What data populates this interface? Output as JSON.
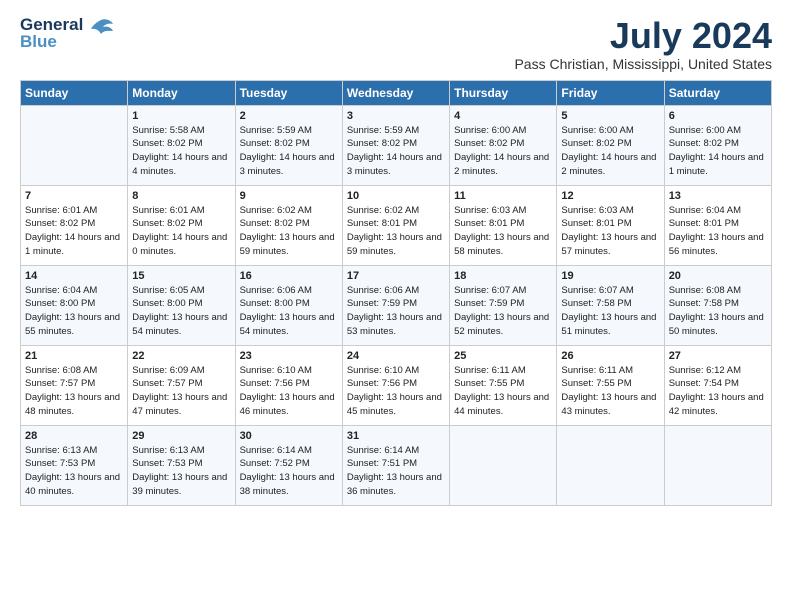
{
  "logo": {
    "line1": "General",
    "line2": "Blue"
  },
  "title": "July 2024",
  "subtitle": "Pass Christian, Mississippi, United States",
  "headers": [
    "Sunday",
    "Monday",
    "Tuesday",
    "Wednesday",
    "Thursday",
    "Friday",
    "Saturday"
  ],
  "weeks": [
    [
      {
        "day": "",
        "sunrise": "",
        "sunset": "",
        "daylight": ""
      },
      {
        "day": "1",
        "sunrise": "Sunrise: 5:58 AM",
        "sunset": "Sunset: 8:02 PM",
        "daylight": "Daylight: 14 hours and 4 minutes."
      },
      {
        "day": "2",
        "sunrise": "Sunrise: 5:59 AM",
        "sunset": "Sunset: 8:02 PM",
        "daylight": "Daylight: 14 hours and 3 minutes."
      },
      {
        "day": "3",
        "sunrise": "Sunrise: 5:59 AM",
        "sunset": "Sunset: 8:02 PM",
        "daylight": "Daylight: 14 hours and 3 minutes."
      },
      {
        "day": "4",
        "sunrise": "Sunrise: 6:00 AM",
        "sunset": "Sunset: 8:02 PM",
        "daylight": "Daylight: 14 hours and 2 minutes."
      },
      {
        "day": "5",
        "sunrise": "Sunrise: 6:00 AM",
        "sunset": "Sunset: 8:02 PM",
        "daylight": "Daylight: 14 hours and 2 minutes."
      },
      {
        "day": "6",
        "sunrise": "Sunrise: 6:00 AM",
        "sunset": "Sunset: 8:02 PM",
        "daylight": "Daylight: 14 hours and 1 minute."
      }
    ],
    [
      {
        "day": "7",
        "sunrise": "Sunrise: 6:01 AM",
        "sunset": "Sunset: 8:02 PM",
        "daylight": "Daylight: 14 hours and 1 minute."
      },
      {
        "day": "8",
        "sunrise": "Sunrise: 6:01 AM",
        "sunset": "Sunset: 8:02 PM",
        "daylight": "Daylight: 14 hours and 0 minutes."
      },
      {
        "day": "9",
        "sunrise": "Sunrise: 6:02 AM",
        "sunset": "Sunset: 8:02 PM",
        "daylight": "Daylight: 13 hours and 59 minutes."
      },
      {
        "day": "10",
        "sunrise": "Sunrise: 6:02 AM",
        "sunset": "Sunset: 8:01 PM",
        "daylight": "Daylight: 13 hours and 59 minutes."
      },
      {
        "day": "11",
        "sunrise": "Sunrise: 6:03 AM",
        "sunset": "Sunset: 8:01 PM",
        "daylight": "Daylight: 13 hours and 58 minutes."
      },
      {
        "day": "12",
        "sunrise": "Sunrise: 6:03 AM",
        "sunset": "Sunset: 8:01 PM",
        "daylight": "Daylight: 13 hours and 57 minutes."
      },
      {
        "day": "13",
        "sunrise": "Sunrise: 6:04 AM",
        "sunset": "Sunset: 8:01 PM",
        "daylight": "Daylight: 13 hours and 56 minutes."
      }
    ],
    [
      {
        "day": "14",
        "sunrise": "Sunrise: 6:04 AM",
        "sunset": "Sunset: 8:00 PM",
        "daylight": "Daylight: 13 hours and 55 minutes."
      },
      {
        "day": "15",
        "sunrise": "Sunrise: 6:05 AM",
        "sunset": "Sunset: 8:00 PM",
        "daylight": "Daylight: 13 hours and 54 minutes."
      },
      {
        "day": "16",
        "sunrise": "Sunrise: 6:06 AM",
        "sunset": "Sunset: 8:00 PM",
        "daylight": "Daylight: 13 hours and 54 minutes."
      },
      {
        "day": "17",
        "sunrise": "Sunrise: 6:06 AM",
        "sunset": "Sunset: 7:59 PM",
        "daylight": "Daylight: 13 hours and 53 minutes."
      },
      {
        "day": "18",
        "sunrise": "Sunrise: 6:07 AM",
        "sunset": "Sunset: 7:59 PM",
        "daylight": "Daylight: 13 hours and 52 minutes."
      },
      {
        "day": "19",
        "sunrise": "Sunrise: 6:07 AM",
        "sunset": "Sunset: 7:58 PM",
        "daylight": "Daylight: 13 hours and 51 minutes."
      },
      {
        "day": "20",
        "sunrise": "Sunrise: 6:08 AM",
        "sunset": "Sunset: 7:58 PM",
        "daylight": "Daylight: 13 hours and 50 minutes."
      }
    ],
    [
      {
        "day": "21",
        "sunrise": "Sunrise: 6:08 AM",
        "sunset": "Sunset: 7:57 PM",
        "daylight": "Daylight: 13 hours and 48 minutes."
      },
      {
        "day": "22",
        "sunrise": "Sunrise: 6:09 AM",
        "sunset": "Sunset: 7:57 PM",
        "daylight": "Daylight: 13 hours and 47 minutes."
      },
      {
        "day": "23",
        "sunrise": "Sunrise: 6:10 AM",
        "sunset": "Sunset: 7:56 PM",
        "daylight": "Daylight: 13 hours and 46 minutes."
      },
      {
        "day": "24",
        "sunrise": "Sunrise: 6:10 AM",
        "sunset": "Sunset: 7:56 PM",
        "daylight": "Daylight: 13 hours and 45 minutes."
      },
      {
        "day": "25",
        "sunrise": "Sunrise: 6:11 AM",
        "sunset": "Sunset: 7:55 PM",
        "daylight": "Daylight: 13 hours and 44 minutes."
      },
      {
        "day": "26",
        "sunrise": "Sunrise: 6:11 AM",
        "sunset": "Sunset: 7:55 PM",
        "daylight": "Daylight: 13 hours and 43 minutes."
      },
      {
        "day": "27",
        "sunrise": "Sunrise: 6:12 AM",
        "sunset": "Sunset: 7:54 PM",
        "daylight": "Daylight: 13 hours and 42 minutes."
      }
    ],
    [
      {
        "day": "28",
        "sunrise": "Sunrise: 6:13 AM",
        "sunset": "Sunset: 7:53 PM",
        "daylight": "Daylight: 13 hours and 40 minutes."
      },
      {
        "day": "29",
        "sunrise": "Sunrise: 6:13 AM",
        "sunset": "Sunset: 7:53 PM",
        "daylight": "Daylight: 13 hours and 39 minutes."
      },
      {
        "day": "30",
        "sunrise": "Sunrise: 6:14 AM",
        "sunset": "Sunset: 7:52 PM",
        "daylight": "Daylight: 13 hours and 38 minutes."
      },
      {
        "day": "31",
        "sunrise": "Sunrise: 6:14 AM",
        "sunset": "Sunset: 7:51 PM",
        "daylight": "Daylight: 13 hours and 36 minutes."
      },
      {
        "day": "",
        "sunrise": "",
        "sunset": "",
        "daylight": ""
      },
      {
        "day": "",
        "sunrise": "",
        "sunset": "",
        "daylight": ""
      },
      {
        "day": "",
        "sunrise": "",
        "sunset": "",
        "daylight": ""
      }
    ]
  ]
}
